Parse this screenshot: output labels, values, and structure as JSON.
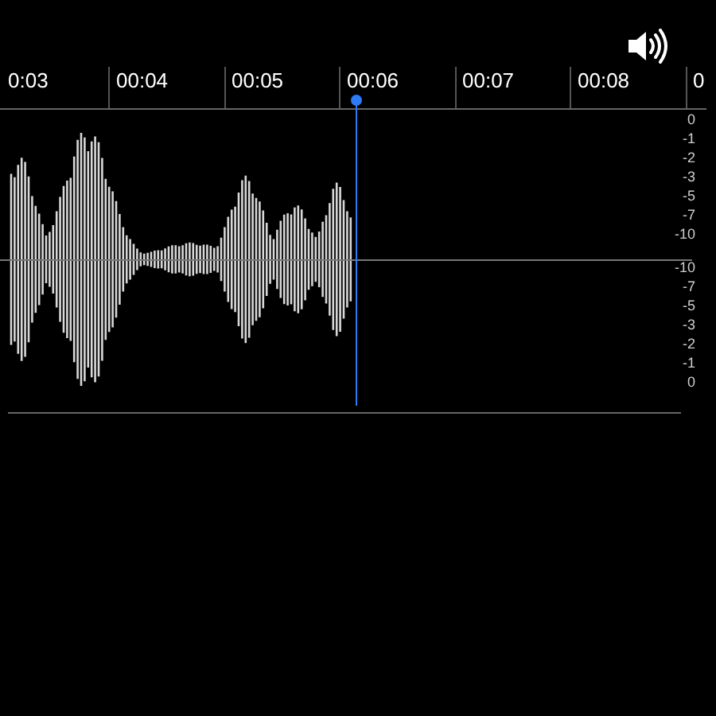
{
  "timeline": {
    "labels": [
      "0:03",
      "00:04",
      "00:05",
      "00:06",
      "00:07",
      "00:08",
      "0"
    ]
  },
  "scale": {
    "upper": [
      "0",
      "-1",
      "-2",
      "-3",
      "-5",
      "-7",
      "-10"
    ],
    "lower": [
      "-10",
      "-7",
      "-5",
      "-3",
      "-2",
      "-1",
      "0"
    ]
  }
}
